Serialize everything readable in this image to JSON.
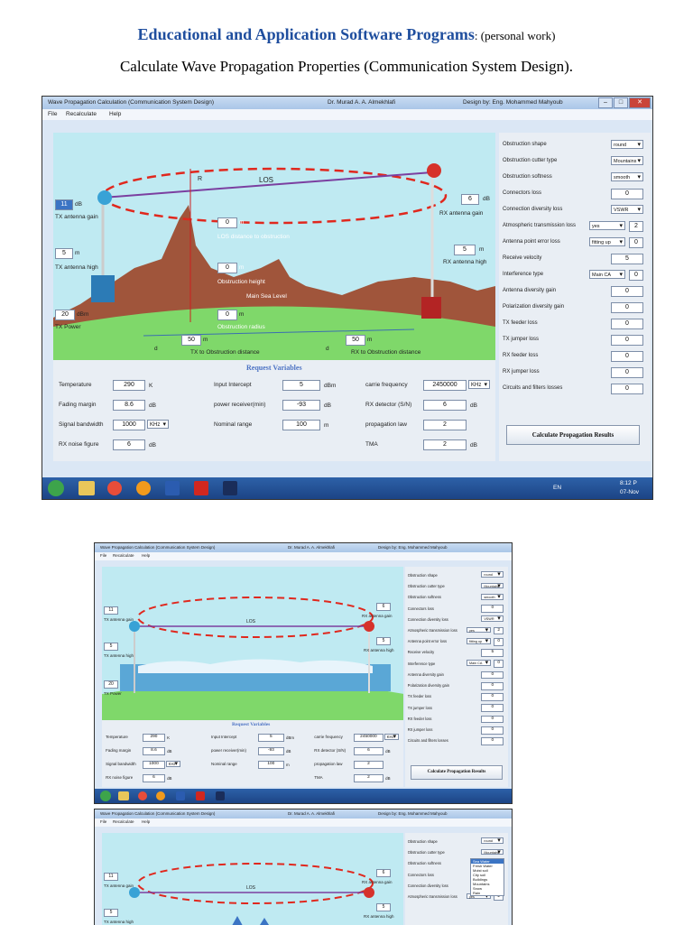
{
  "doc": {
    "heading": "Educational and Application Software Programs",
    "heading_suffix": ": (personal work)",
    "subheading": "Calculate Wave Propagation Properties (Communication System Design)."
  },
  "window": {
    "title": "Wave Propagation Calculation (Communication System Design)",
    "author": "Dr. Murad A. A. Almekhlafi",
    "designer": "Design by: Eng. Mohammed Mahyoub",
    "menu": [
      "File",
      "Recalculate",
      "Help"
    ]
  },
  "scene": {
    "los": "LOS",
    "r_sg": "R",
    "tx_gain_value": "11",
    "tx_gain_unit": "dB",
    "tx_gain_label": "TX antenna gain",
    "rx_gain_value": "6",
    "rx_gain_unit": "dB",
    "rx_gain_label": "RX antenna gain",
    "tx_high_value": "5",
    "tx_high_unit": "m",
    "tx_high_label": "TX antenna high",
    "rx_high_value": "5",
    "rx_high_unit": "m",
    "rx_high_label": "RX antenna high",
    "tx_power_value": "20",
    "tx_power_unit": "dBm",
    "tx_power_label": "TX Power",
    "los_obs_value": "0",
    "los_obs_unit": "m",
    "los_obs_label": "LOS distance to obstruction",
    "obs_height_value": "0",
    "obs_height_unit": "m",
    "obs_height_label": "Obstruction height",
    "main_sea_level": "Main Sea Level",
    "obs_radius_value": "0",
    "obs_radius_unit": "m",
    "obs_radius_label": "Obstruction radius",
    "tx_obs_value": "50",
    "tx_obs_unit": "m",
    "tx_obs_label": "TX to Obstruction distance",
    "rx_obs_value": "50",
    "rx_obs_unit": "m",
    "rx_obs_label": "RX to Obstruction distance",
    "d1": "d",
    "d2": "d"
  },
  "request": {
    "title": "Request Variables",
    "col1": [
      {
        "label": "Temperature",
        "value": "290",
        "unit": "K"
      },
      {
        "label": "Fading margin",
        "value": "8.6",
        "unit": "dB"
      },
      {
        "label": "Signal bandwidth",
        "value": "1000",
        "unit": "KHz"
      },
      {
        "label": "RX noise figure",
        "value": "6",
        "unit": "dB"
      }
    ],
    "col2": [
      {
        "label": "Input Intercept",
        "value": "5",
        "unit": "dBm"
      },
      {
        "label": "power receiver(min)",
        "value": "-93",
        "unit": "dB"
      },
      {
        "label": "Nominal range",
        "value": "100",
        "unit": "m"
      }
    ],
    "col3": [
      {
        "label": "carrie frequency",
        "value": "2450000",
        "unit": "KHz"
      },
      {
        "label": "RX detector (S/N)",
        "value": "6",
        "unit": "dB"
      },
      {
        "label": "propagation law",
        "value": "2",
        "unit": ""
      },
      {
        "label": "TMA",
        "value": "2",
        "unit": "dB"
      }
    ]
  },
  "right": {
    "rows": [
      {
        "label": "Obstruction shape",
        "value": "round"
      },
      {
        "label": "Obstruction cutter type",
        "value": "Mountains"
      },
      {
        "label": "Obstruction softness",
        "value": "smooth"
      },
      {
        "label": "Connectors loss",
        "value": "0"
      },
      {
        "label": "Connection diversity loss",
        "value": "VSWR"
      },
      {
        "label": "Atmospheric transmission loss",
        "value": "2",
        "sel": "yes"
      },
      {
        "label": "Antenna point error loss",
        "value": "0",
        "sel": "fitting up"
      },
      {
        "label": "Receive velocity",
        "value": "5"
      },
      {
        "label": "Interference type",
        "value": "0",
        "sel": "Main CA"
      },
      {
        "label": "Antenna diversity gain",
        "value": "0"
      },
      {
        "label": "Polarization diversity gain",
        "value": "0"
      },
      {
        "label": "TX feeder loss",
        "value": "0"
      },
      {
        "label": "TX jumper loss",
        "value": "0"
      },
      {
        "label": "RX feeder loss",
        "value": "0"
      },
      {
        "label": "RX jumper loss",
        "value": "0"
      },
      {
        "label": "Circuits and filters losses",
        "value": "0"
      }
    ],
    "button": "Calculate Propagation Results",
    "unit": "dB"
  },
  "taskbar": {
    "lang": "EN",
    "time": "8:12 P",
    "date": "07-Nov"
  },
  "dropdown_options": [
    "Sea Water",
    "Fresh Water",
    "Moist soil",
    "City soil",
    "Buildings",
    "Mountains",
    "Snow",
    "Rain"
  ],
  "colors": {
    "accent": "#1f4e9e",
    "sky": "#bfeaf2",
    "hill": "#a0553b",
    "ground": "#7fd86a",
    "los_ellipse": "#e0281e"
  }
}
